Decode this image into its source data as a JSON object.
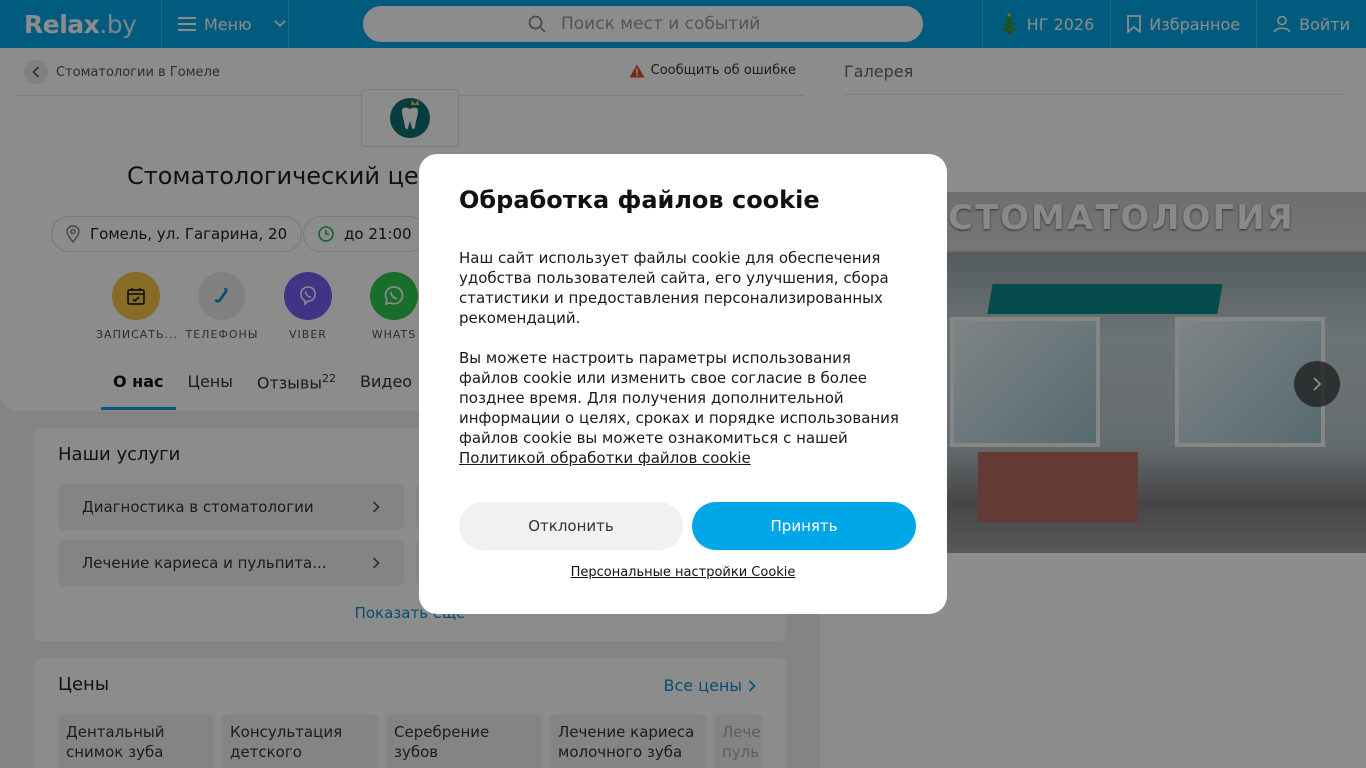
{
  "header": {
    "logo_main": "Relax",
    "logo_suffix": ".by",
    "menu_label": "Меню",
    "search_placeholder": "Поиск мест и событий",
    "ny_label": "НГ 2026",
    "favorites_label": "Избранное",
    "login_label": "Войти"
  },
  "page": {
    "breadcrumb": "Стоматологии в Гомеле",
    "report_label": "Сообщить об ошибке",
    "title": "Стоматологический це",
    "address": "Гомель, ул. Гагарина, 20",
    "hours": "до 21:00",
    "actions": [
      {
        "label": "ЗАПИСАТЬ...",
        "color": "#f5c542"
      },
      {
        "label": "ТЕЛЕФОНЫ",
        "color": "#ececec"
      },
      {
        "label": "VIBER",
        "color": "#7360f2"
      },
      {
        "label": "WHATS",
        "color": "#2cc84d"
      }
    ],
    "tabs": [
      {
        "label": "О нас",
        "active": true
      },
      {
        "label": "Цены"
      },
      {
        "label": "Отзывы",
        "count": "22"
      },
      {
        "label": "Видео"
      }
    ]
  },
  "services": {
    "title": "Наши услуги",
    "items": [
      "Диагностика в стоматологии",
      "Лечение кариеса и пульпита..."
    ],
    "show_more": "Показать еще"
  },
  "prices": {
    "title": "Цены",
    "all_label": "Все цены",
    "items": [
      "Дентальный снимок зуба",
      "Консультация детского",
      "Серебрение зубов",
      "Лечение кариеса молочного зуба",
      "Лече пуль"
    ]
  },
  "gallery": {
    "label": "Галерея",
    "photo_sign": "СТОМАТОЛОГИЯ"
  },
  "cookie": {
    "title": "Обработка файлов cookie",
    "paragraph1": "Наш сайт использует файлы cookie для обеспечения удобства пользователей сайта, его улучшения, сбора статистики и предоставления персонализированных рекомендаций.",
    "paragraph2": "Вы можете настроить параметры использования файлов cookie или изменить свое согласие в более позднее время. Для получения дополнительной информации о целях, сроках и порядке использования файлов cookie вы можете ознакомиться с нашей ",
    "policy_link": "Политикой обработки файлов cookie",
    "decline_label": "Отклонить",
    "accept_label": "Принять",
    "personal_settings_label": "Персональные настройки Cookie"
  },
  "colors": {
    "brand": "#00a7e8",
    "link": "#0b8fcc",
    "warning": "#e04b2a"
  }
}
